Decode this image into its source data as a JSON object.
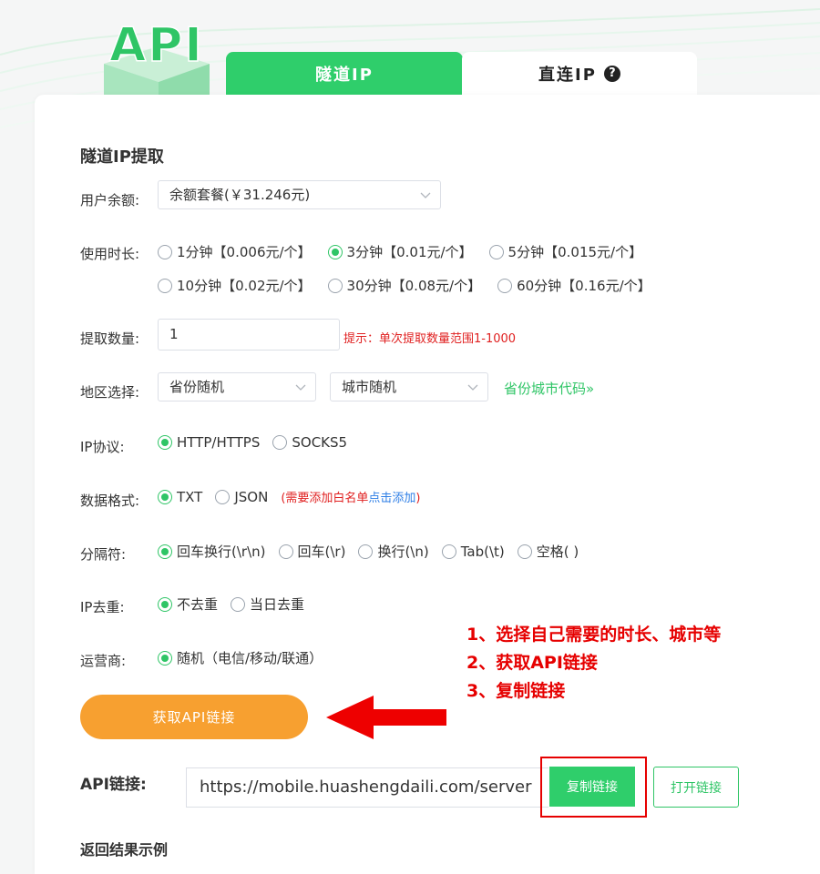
{
  "logo": {
    "text": "API"
  },
  "tabs": [
    {
      "label": "隧道IP",
      "active": true
    },
    {
      "label": "直连IP",
      "active": false
    }
  ],
  "form": {
    "section_title": "隧道IP提取",
    "balance": {
      "label": "用户余额:",
      "value": "余额套餐(￥31.246元)"
    },
    "duration": {
      "label": "使用时长:",
      "options": [
        {
          "label": "1分钟【0.006元/个】",
          "selected": false
        },
        {
          "label": "3分钟【0.01元/个】",
          "selected": true
        },
        {
          "label": "5分钟【0.015元/个】",
          "selected": false
        },
        {
          "label": "10分钟【0.02元/个】",
          "selected": false
        },
        {
          "label": "30分钟【0.08元/个】",
          "selected": false
        },
        {
          "label": "60分钟【0.16元/个】",
          "selected": false
        }
      ]
    },
    "quantity": {
      "label": "提取数量:",
      "value": "1",
      "hint": "提示：单次提取数量范围1-1000"
    },
    "region": {
      "label": "地区选择:",
      "province": "省份随机",
      "city": "城市随机",
      "code_link": "省份城市代码»"
    },
    "protocol": {
      "label": "IP协议:",
      "options": [
        {
          "label": "HTTP/HTTPS",
          "selected": true
        },
        {
          "label": "SOCKS5",
          "selected": false
        }
      ]
    },
    "format": {
      "label": "数据格式:",
      "options": [
        {
          "label": "TXT",
          "selected": true
        },
        {
          "label": "JSON",
          "selected": false
        }
      ],
      "note_prefix": "(需要添加白名单",
      "note_link": "点击添加",
      "note_suffix": ")"
    },
    "separator": {
      "label": "分隔符:",
      "options": [
        {
          "label": "回车换行(\\r\\n)",
          "selected": true
        },
        {
          "label": "回车(\\r)",
          "selected": false
        },
        {
          "label": "换行(\\n)",
          "selected": false
        },
        {
          "label": "Tab(\\t)",
          "selected": false
        },
        {
          "label": "空格( )",
          "selected": false
        }
      ]
    },
    "dedup": {
      "label": "IP去重:",
      "options": [
        {
          "label": "不去重",
          "selected": true
        },
        {
          "label": "当日去重",
          "selected": false
        }
      ]
    },
    "carrier": {
      "label": "运营商:",
      "options": [
        {
          "label": "随机（电信/移动/联通）",
          "selected": true
        }
      ]
    },
    "get_button": "获取API链接"
  },
  "annotation": {
    "steps": [
      "1、选择自己需要的时长、城市等",
      "2、获取API链接",
      "3、复制链接"
    ]
  },
  "api": {
    "label": "API链接:",
    "url": "https://mobile.huashengdaili.com/server",
    "copy_button": "复制链接",
    "open_button": "打开链接"
  },
  "result": {
    "title": "返回结果示例"
  },
  "colors": {
    "brand_green": "#2fce6b",
    "button_orange": "#f7a030",
    "annotation_red": "#e60000",
    "link_blue": "#2d7ee6"
  }
}
